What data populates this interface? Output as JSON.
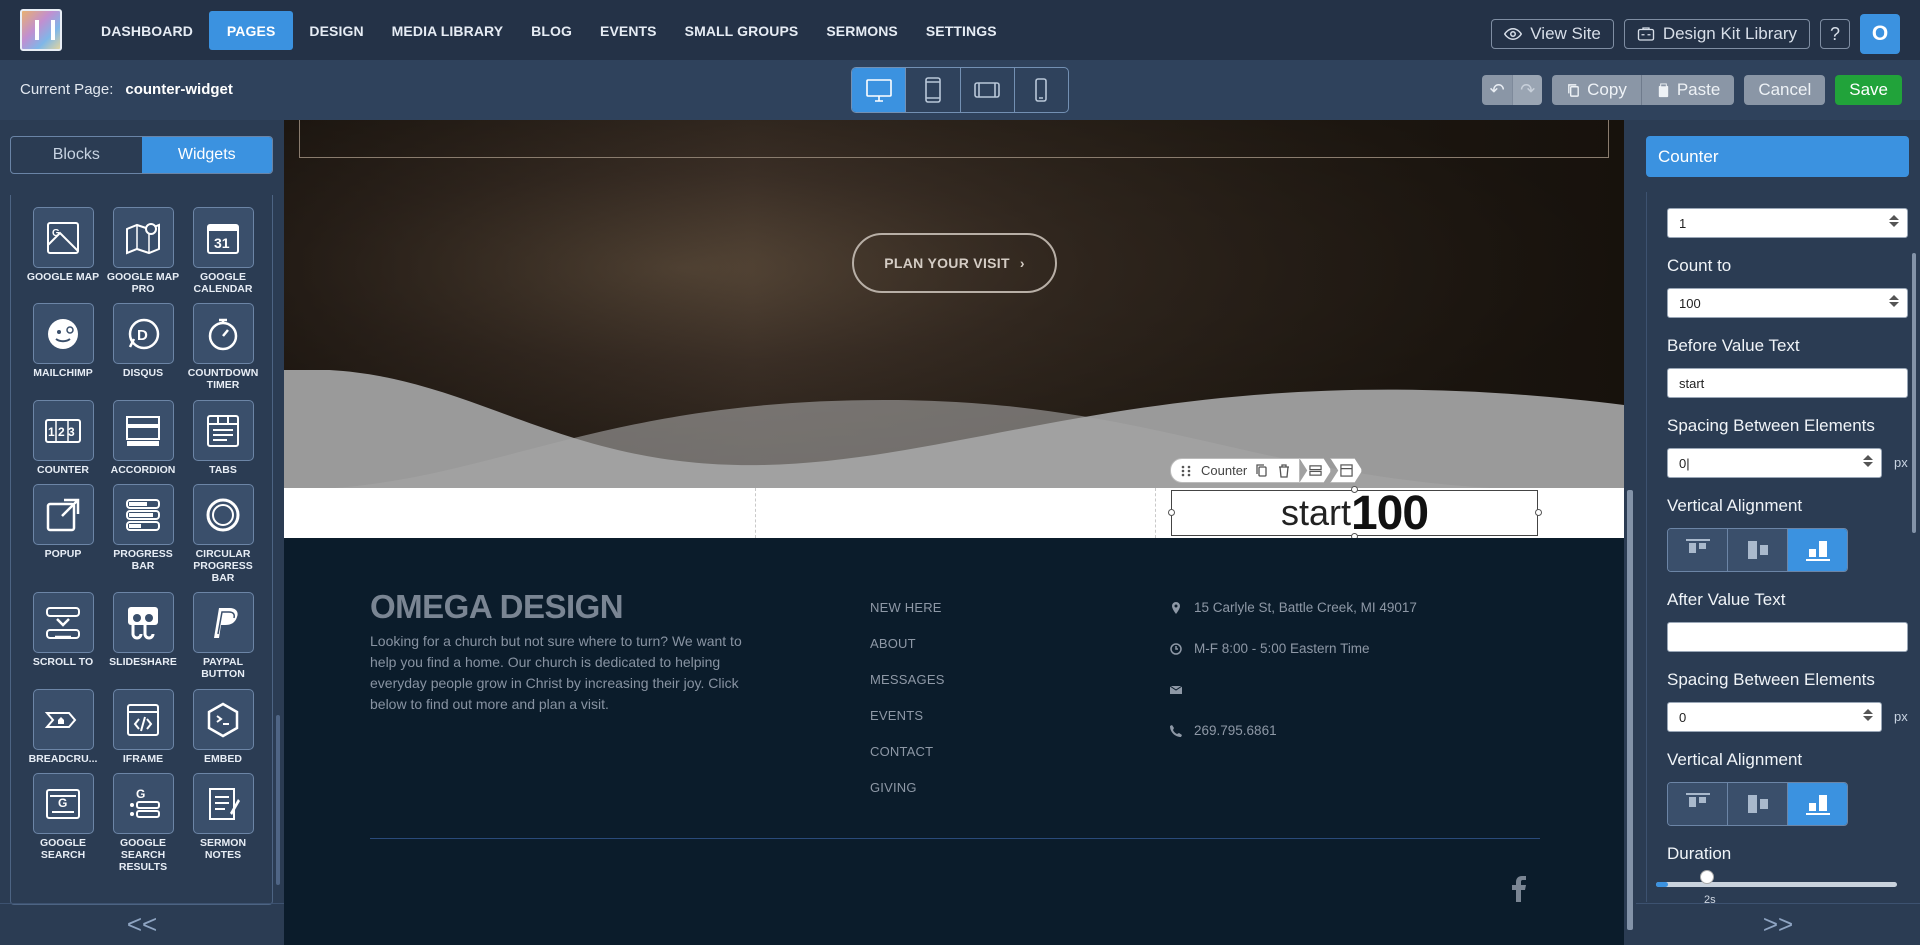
{
  "nav": {
    "items": [
      {
        "label": "DASHBOARD"
      },
      {
        "label": "PAGES",
        "active": true
      },
      {
        "label": "DESIGN"
      },
      {
        "label": "MEDIA LIBRARY"
      },
      {
        "label": "BLOG"
      },
      {
        "label": "EVENTS"
      },
      {
        "label": "SMALL GROUPS"
      },
      {
        "label": "SERMONS"
      },
      {
        "label": "SETTINGS"
      }
    ],
    "view_site": "View Site",
    "design_kit": "Design Kit Library",
    "help": "?",
    "avatar_initial": "O"
  },
  "subbar": {
    "current_page_label": "Current Page:",
    "current_page_value": "counter-widget",
    "devices": [
      "desktop-icon",
      "tablet-icon",
      "tablet-landscape-icon",
      "phone-icon"
    ],
    "copy": "Copy",
    "paste": "Paste",
    "cancel": "Cancel",
    "save": "Save"
  },
  "left": {
    "tabs": [
      "Blocks",
      "Widgets"
    ],
    "active_tab": "Widgets",
    "widgets": [
      {
        "label": "GOOGLE MAP",
        "icon": "google-map-icon"
      },
      {
        "label": "GOOGLE MAP PRO",
        "icon": "google-map-pro-icon"
      },
      {
        "label": "GOOGLE CALENDAR",
        "icon": "google-calendar-icon",
        "badge": "31"
      },
      {
        "label": "MAILCHIMP",
        "icon": "mailchimp-icon"
      },
      {
        "label": "DISQUS",
        "icon": "disqus-icon"
      },
      {
        "label": "COUNTDOWN TIMER",
        "icon": "stopwatch-icon"
      },
      {
        "label": "COUNTER",
        "icon": "counter-icon"
      },
      {
        "label": "ACCORDION",
        "icon": "accordion-icon"
      },
      {
        "label": "TABS",
        "icon": "tabs-icon"
      },
      {
        "label": "POPUP",
        "icon": "popup-icon"
      },
      {
        "label": "PROGRESS BAR",
        "icon": "progress-bar-icon"
      },
      {
        "label": "CIRCULAR PROGRESS BAR",
        "icon": "circular-progress-icon"
      },
      {
        "label": "SCROLL TO",
        "icon": "scroll-to-icon"
      },
      {
        "label": "SLIDESHARE",
        "icon": "slideshare-icon"
      },
      {
        "label": "PAYPAL BUTTON",
        "icon": "paypal-icon"
      },
      {
        "label": "BREADCRU...",
        "icon": "breadcrumb-icon"
      },
      {
        "label": "IFRAME",
        "icon": "iframe-icon"
      },
      {
        "label": "EMBED",
        "icon": "embed-icon"
      },
      {
        "label": "GOOGLE SEARCH",
        "icon": "google-search-icon"
      },
      {
        "label": "GOOGLE SEARCH RESULTS",
        "icon": "google-search-results-icon"
      },
      {
        "label": "SERMON NOTES",
        "icon": "sermon-notes-icon"
      }
    ],
    "collapse": "<<"
  },
  "canvas": {
    "plan_visit": "PLAN YOUR VISIT",
    "widget_toolbar_label": "Counter",
    "counter_before": "start",
    "counter_value": "100",
    "footer": {
      "title": "OMEGA DESIGN",
      "text": "Looking for a church but not sure where to turn? We want to help you find a home. Our church is dedicated to helping everyday people grow in Christ by increasing their joy.  Click below to find out more and plan a visit.",
      "links": [
        "NEW HERE",
        "ABOUT",
        "MESSAGES",
        "EVENTS",
        "CONTACT",
        "GIVING"
      ],
      "address": "15 Carlyle St, Battle Creek, MI 49017",
      "hours": "M-F 8:00 - 5:00 Eastern Time",
      "email": "",
      "phone": "269.795.6861"
    }
  },
  "right": {
    "header": "Counter",
    "count_from_value": "1",
    "count_to_label": "Count to",
    "count_to_value": "100",
    "before_text_label": "Before Value Text",
    "before_text_value": "start",
    "spacing1_label": "Spacing Between Elements",
    "spacing1_value": "0",
    "unit": "px",
    "valign1_label": "Vertical Alignment",
    "after_text_label": "After Value Text",
    "after_text_value": "",
    "spacing2_label": "Spacing Between Elements",
    "spacing2_value": "0",
    "valign2_label": "Vertical Alignment",
    "duration_label": "Duration",
    "duration_value": "2s",
    "duration_fraction": 0.24,
    "collapse": ">>"
  }
}
